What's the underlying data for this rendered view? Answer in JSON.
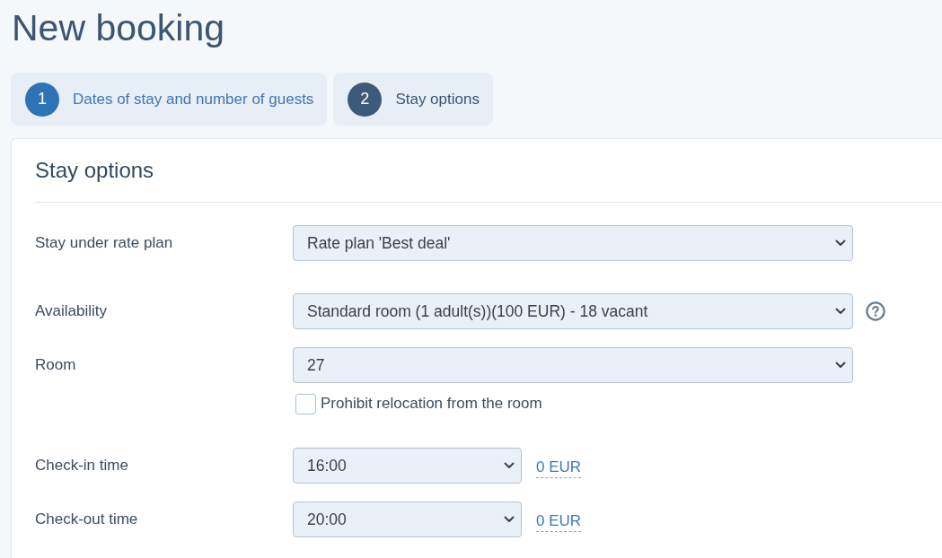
{
  "page": {
    "title": "New booking"
  },
  "steps": [
    {
      "number": "1",
      "label": "Dates of stay and number of guests",
      "selected": false
    },
    {
      "number": "2",
      "label": "Stay options",
      "selected": true
    }
  ],
  "panel": {
    "title": "Stay options",
    "sections": [
      {
        "fields": [
          {
            "kind": "select",
            "label": "Stay under rate plan",
            "value": "Rate plan 'Best deal'"
          }
        ]
      },
      {
        "fields": [
          {
            "kind": "select_help",
            "label": "Availability",
            "value": "Standard room (1 adult(s))(100 EUR) - 18 vacant"
          },
          {
            "kind": "select",
            "label": "Room",
            "value": "27",
            "option": {
              "label": "Prohibit relocation from the room",
              "checked": false
            }
          }
        ]
      },
      {
        "fields": [
          {
            "kind": "time",
            "label": "Check-in time",
            "value": "16:00",
            "price": "0 EUR"
          },
          {
            "kind": "time",
            "label": "Check-out time",
            "value": "20:00",
            "price": "0 EUR"
          }
        ]
      }
    ]
  }
}
